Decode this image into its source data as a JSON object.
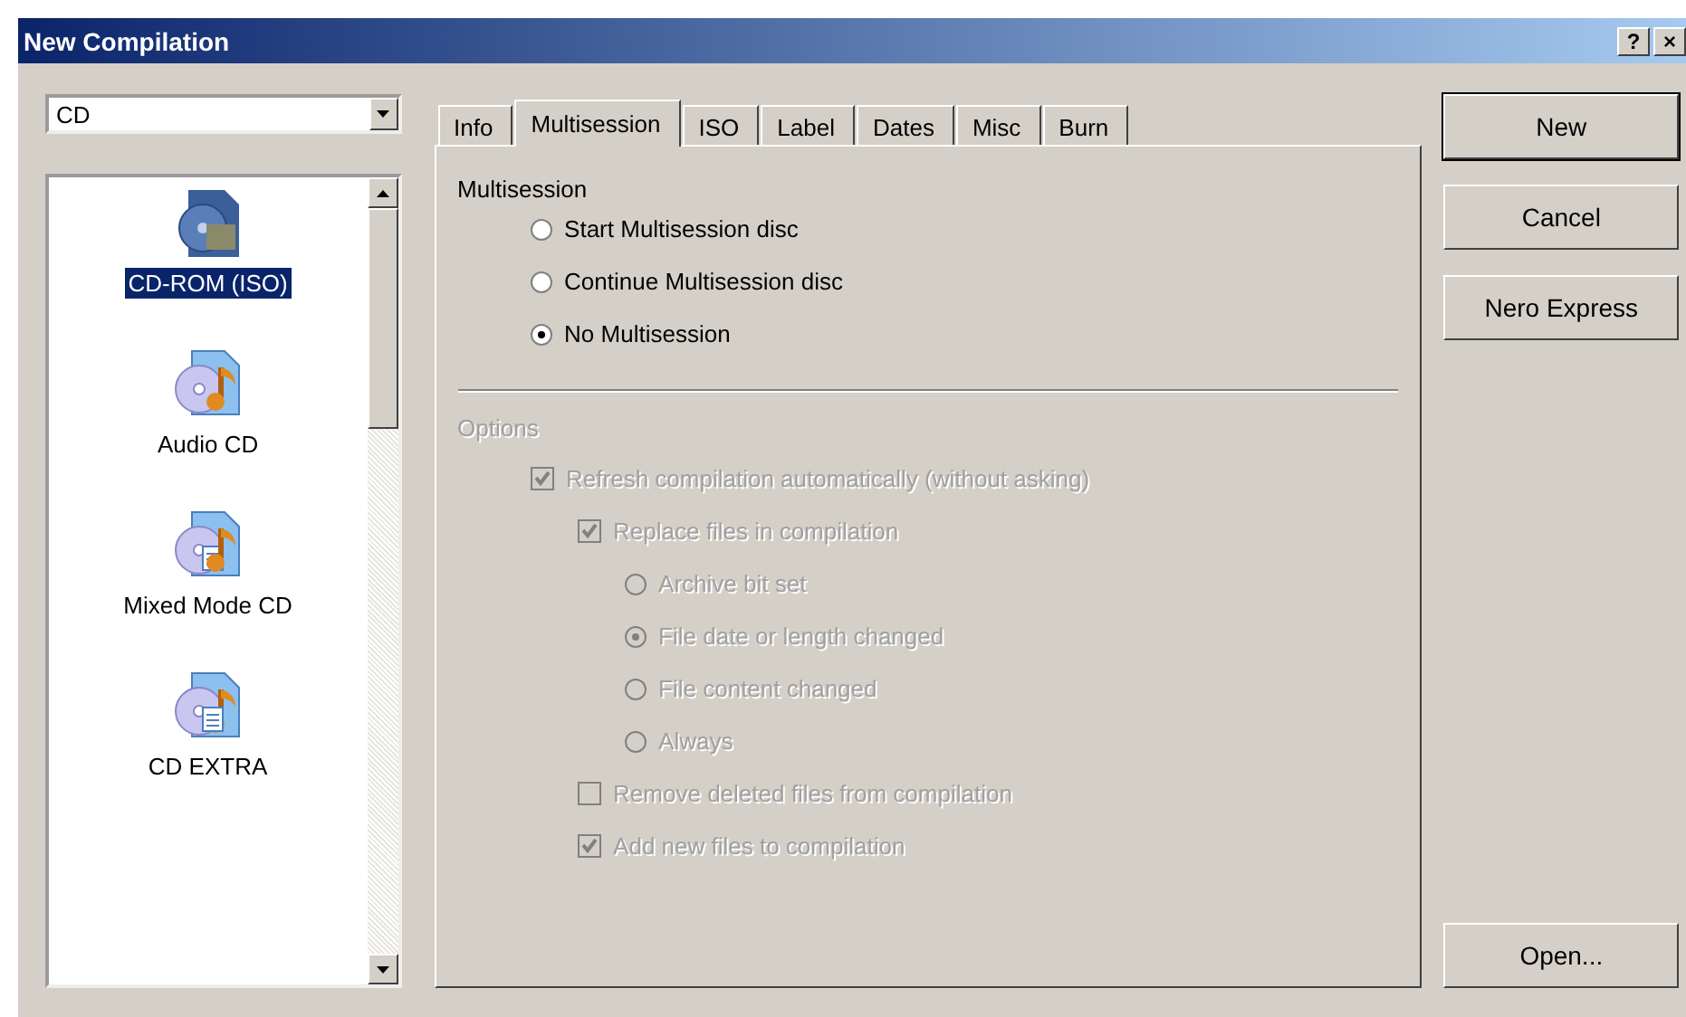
{
  "window": {
    "title": "New Compilation",
    "title_buttons": [
      "?",
      "×"
    ]
  },
  "disc_type": {
    "value": "CD"
  },
  "compilations": [
    {
      "kind": "data",
      "label": "CD-ROM (ISO)",
      "selected": true
    },
    {
      "kind": "audio",
      "label": "Audio CD",
      "selected": false
    },
    {
      "kind": "mixed",
      "label": "Mixed Mode CD",
      "selected": false
    },
    {
      "kind": "extra",
      "label": "CD EXTRA",
      "selected": false
    }
  ],
  "tabs": [
    {
      "label": "Info",
      "selected": false
    },
    {
      "label": "Multisession",
      "selected": true
    },
    {
      "label": "ISO",
      "selected": false
    },
    {
      "label": "Label",
      "selected": false
    },
    {
      "label": "Dates",
      "selected": false
    },
    {
      "label": "Misc",
      "selected": false
    },
    {
      "label": "Burn",
      "selected": false
    }
  ],
  "multisession": {
    "title": "Multisession",
    "items": [
      {
        "label": "Start Multisession disc",
        "selected": false
      },
      {
        "label": "Continue Multisession disc",
        "selected": false
      },
      {
        "label": "No Multisession",
        "selected": true
      }
    ]
  },
  "options": {
    "title": "Options",
    "disabled": true,
    "items": [
      {
        "kind": "checkbox",
        "label": "Refresh compilation automatically (without asking)",
        "checked": true,
        "children": [
          {
            "kind": "checkbox",
            "label": "Replace files in compilation",
            "checked": true,
            "children": [
              {
                "kind": "radio",
                "label": "Archive bit set",
                "selected": false
              },
              {
                "kind": "radio",
                "label": "File date or length changed",
                "selected": true
              },
              {
                "kind": "radio",
                "label": "File content changed",
                "selected": false
              },
              {
                "kind": "radio",
                "label": "Always",
                "selected": false
              }
            ]
          },
          {
            "kind": "checkbox",
            "label": "Remove deleted files from compilation",
            "checked": false
          },
          {
            "kind": "checkbox",
            "label": "Add new files to compilation",
            "checked": true
          }
        ]
      }
    ]
  },
  "buttons": [
    {
      "label": "New",
      "default": true
    },
    {
      "label": "Cancel",
      "default": false
    },
    {
      "label": "Nero Express",
      "default": false
    }
  ],
  "bottom_buttons": [
    {
      "label": "Open...",
      "default": false
    }
  ]
}
